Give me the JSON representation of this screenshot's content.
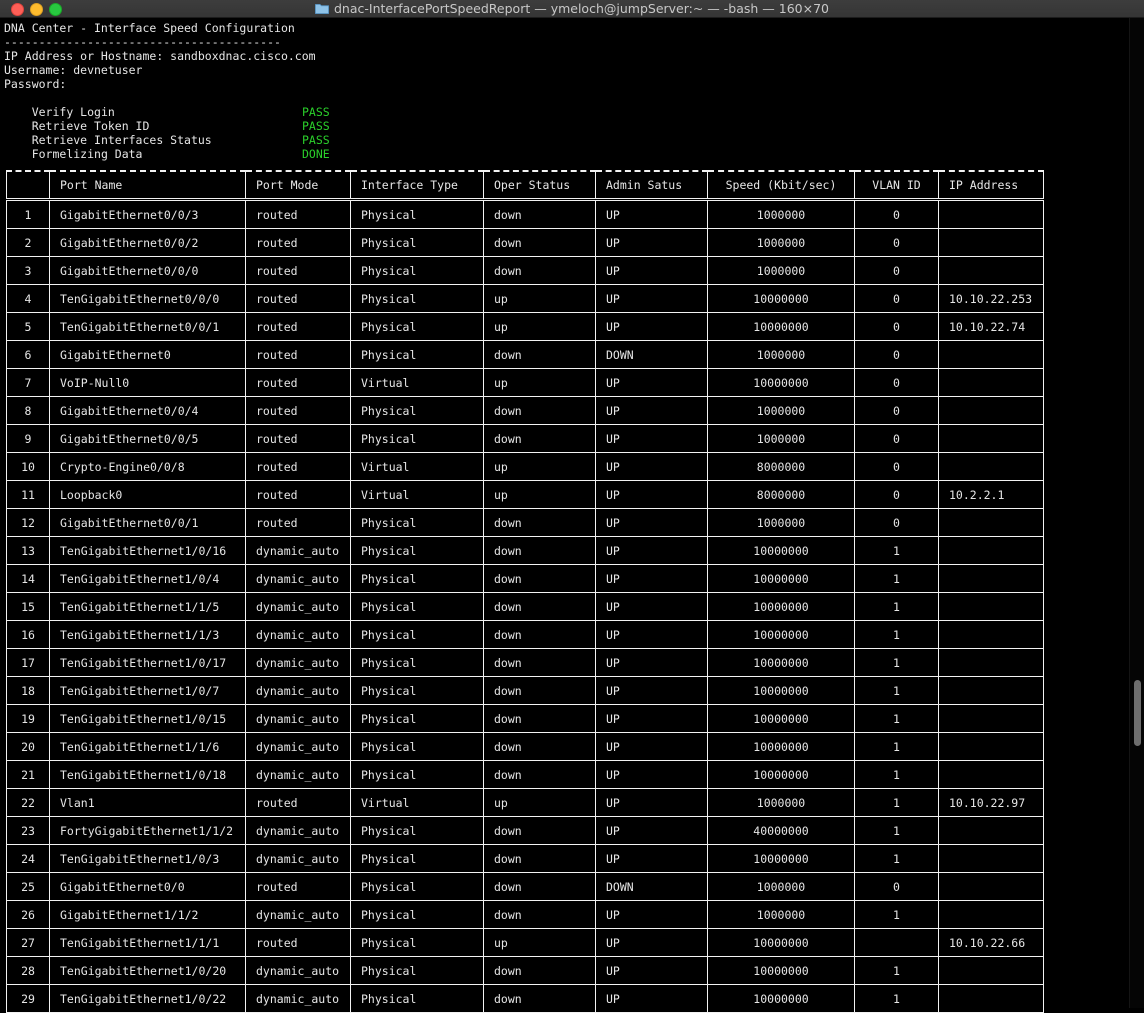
{
  "window": {
    "title": "dnac-InterfacePortSpeedReport — ymeloch@jumpServer:~ — -bash — 160×70"
  },
  "colors": {
    "status": "#2bd02b",
    "background": "#000000",
    "text": "#e6e6e6"
  },
  "console": {
    "heading": "DNA Center - Interface Speed Configuration",
    "rule": "----------------------------------------",
    "host_line": "IP Address or Hostname: sandboxdnac.cisco.com",
    "user_line": "Username: devnetuser",
    "password_line": "Password:",
    "checks": [
      {
        "label": "Verify Login",
        "status": "PASS"
      },
      {
        "label": "Retrieve Token ID",
        "status": "PASS"
      },
      {
        "label": "Retrieve Interfaces Status",
        "status": "PASS"
      },
      {
        "label": "Formelizing Data",
        "status": "DONE"
      }
    ]
  },
  "table": {
    "headers": [
      "",
      "Port Name",
      "Port Mode",
      "Interface Type",
      "Oper Status",
      "Admin Satus",
      "Speed (Kbit/sec)",
      "VLAN ID",
      "IP Address"
    ],
    "rows": [
      [
        "1",
        "GigabitEthernet0/0/3",
        "routed",
        "Physical",
        "down",
        "UP",
        "1000000",
        "0",
        ""
      ],
      [
        "2",
        "GigabitEthernet0/0/2",
        "routed",
        "Physical",
        "down",
        "UP",
        "1000000",
        "0",
        ""
      ],
      [
        "3",
        "GigabitEthernet0/0/0",
        "routed",
        "Physical",
        "down",
        "UP",
        "1000000",
        "0",
        ""
      ],
      [
        "4",
        "TenGigabitEthernet0/0/0",
        "routed",
        "Physical",
        "up",
        "UP",
        "10000000",
        "0",
        "10.10.22.253"
      ],
      [
        "5",
        "TenGigabitEthernet0/0/1",
        "routed",
        "Physical",
        "up",
        "UP",
        "10000000",
        "0",
        "10.10.22.74"
      ],
      [
        "6",
        "GigabitEthernet0",
        "routed",
        "Physical",
        "down",
        "DOWN",
        "1000000",
        "0",
        ""
      ],
      [
        "7",
        "VoIP-Null0",
        "routed",
        "Virtual",
        "up",
        "UP",
        "10000000",
        "0",
        ""
      ],
      [
        "8",
        "GigabitEthernet0/0/4",
        "routed",
        "Physical",
        "down",
        "UP",
        "1000000",
        "0",
        ""
      ],
      [
        "9",
        "GigabitEthernet0/0/5",
        "routed",
        "Physical",
        "down",
        "UP",
        "1000000",
        "0",
        ""
      ],
      [
        "10",
        "Crypto-Engine0/0/8",
        "routed",
        "Virtual",
        "up",
        "UP",
        "8000000",
        "0",
        ""
      ],
      [
        "11",
        "Loopback0",
        "routed",
        "Virtual",
        "up",
        "UP",
        "8000000",
        "0",
        "10.2.2.1"
      ],
      [
        "12",
        "GigabitEthernet0/0/1",
        "routed",
        "Physical",
        "down",
        "UP",
        "1000000",
        "0",
        ""
      ],
      [
        "13",
        "TenGigabitEthernet1/0/16",
        "dynamic_auto",
        "Physical",
        "down",
        "UP",
        "10000000",
        "1",
        ""
      ],
      [
        "14",
        "TenGigabitEthernet1/0/4",
        "dynamic_auto",
        "Physical",
        "down",
        "UP",
        "10000000",
        "1",
        ""
      ],
      [
        "15",
        "TenGigabitEthernet1/1/5",
        "dynamic_auto",
        "Physical",
        "down",
        "UP",
        "10000000",
        "1",
        ""
      ],
      [
        "16",
        "TenGigabitEthernet1/1/3",
        "dynamic_auto",
        "Physical",
        "down",
        "UP",
        "10000000",
        "1",
        ""
      ],
      [
        "17",
        "TenGigabitEthernet1/0/17",
        "dynamic_auto",
        "Physical",
        "down",
        "UP",
        "10000000",
        "1",
        ""
      ],
      [
        "18",
        "TenGigabitEthernet1/0/7",
        "dynamic_auto",
        "Physical",
        "down",
        "UP",
        "10000000",
        "1",
        ""
      ],
      [
        "19",
        "TenGigabitEthernet1/0/15",
        "dynamic_auto",
        "Physical",
        "down",
        "UP",
        "10000000",
        "1",
        ""
      ],
      [
        "20",
        "TenGigabitEthernet1/1/6",
        "dynamic_auto",
        "Physical",
        "down",
        "UP",
        "10000000",
        "1",
        ""
      ],
      [
        "21",
        "TenGigabitEthernet1/0/18",
        "dynamic_auto",
        "Physical",
        "down",
        "UP",
        "10000000",
        "1",
        ""
      ],
      [
        "22",
        "Vlan1",
        "routed",
        "Virtual",
        "up",
        "UP",
        "1000000",
        "1",
        "10.10.22.97"
      ],
      [
        "23",
        "FortyGigabitEthernet1/1/2",
        "dynamic_auto",
        "Physical",
        "down",
        "UP",
        "40000000",
        "1",
        ""
      ],
      [
        "24",
        "TenGigabitEthernet1/0/3",
        "dynamic_auto",
        "Physical",
        "down",
        "UP",
        "10000000",
        "1",
        ""
      ],
      [
        "25",
        "GigabitEthernet0/0",
        "routed",
        "Physical",
        "down",
        "DOWN",
        "1000000",
        "0",
        ""
      ],
      [
        "26",
        "GigabitEthernet1/1/2",
        "dynamic_auto",
        "Physical",
        "down",
        "UP",
        "1000000",
        "1",
        ""
      ],
      [
        "27",
        "TenGigabitEthernet1/1/1",
        "routed",
        "Physical",
        "up",
        "UP",
        "10000000",
        "",
        "10.10.22.66"
      ],
      [
        "28",
        "TenGigabitEthernet1/0/20",
        "dynamic_auto",
        "Physical",
        "down",
        "UP",
        "10000000",
        "1",
        ""
      ],
      [
        "29",
        "TenGigabitEthernet1/0/22",
        "dynamic_auto",
        "Physical",
        "down",
        "UP",
        "10000000",
        "1",
        ""
      ]
    ]
  }
}
